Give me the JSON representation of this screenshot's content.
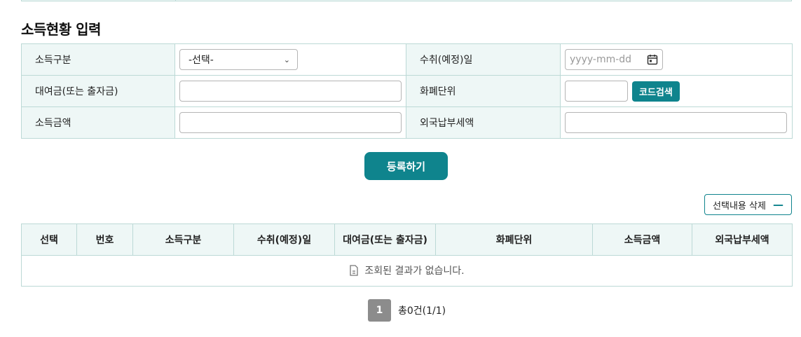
{
  "section": {
    "title": "소득현황 입력"
  },
  "form": {
    "income_type_label": "소득구분",
    "income_type_value": "-선택-",
    "receipt_date_label": "수취(예정)일",
    "receipt_date_placeholder": "yyyy-mm-dd",
    "loan_label": "대여금(또는 출자금)",
    "currency_label": "화폐단위",
    "code_search_label": "코드검색",
    "income_amount_label": "소득금액",
    "foreign_tax_label": "외국납부세액"
  },
  "actions": {
    "register_label": "등록하기",
    "delete_selected_label": "선택내용 삭제"
  },
  "list": {
    "columns": [
      "선택",
      "번호",
      "소득구분",
      "수취(예정)일",
      "대여금(또는 출자금)",
      "화폐단위",
      "소득금액",
      "외국납부세액"
    ],
    "empty_message": "조회된 결과가 없습니다."
  },
  "pagination": {
    "current_page": "1",
    "total_text": "총0건(1/1)"
  },
  "colors": {
    "accent": "#0f848d",
    "header_bg": "#eef7f6",
    "border": "#bcd9d6"
  }
}
